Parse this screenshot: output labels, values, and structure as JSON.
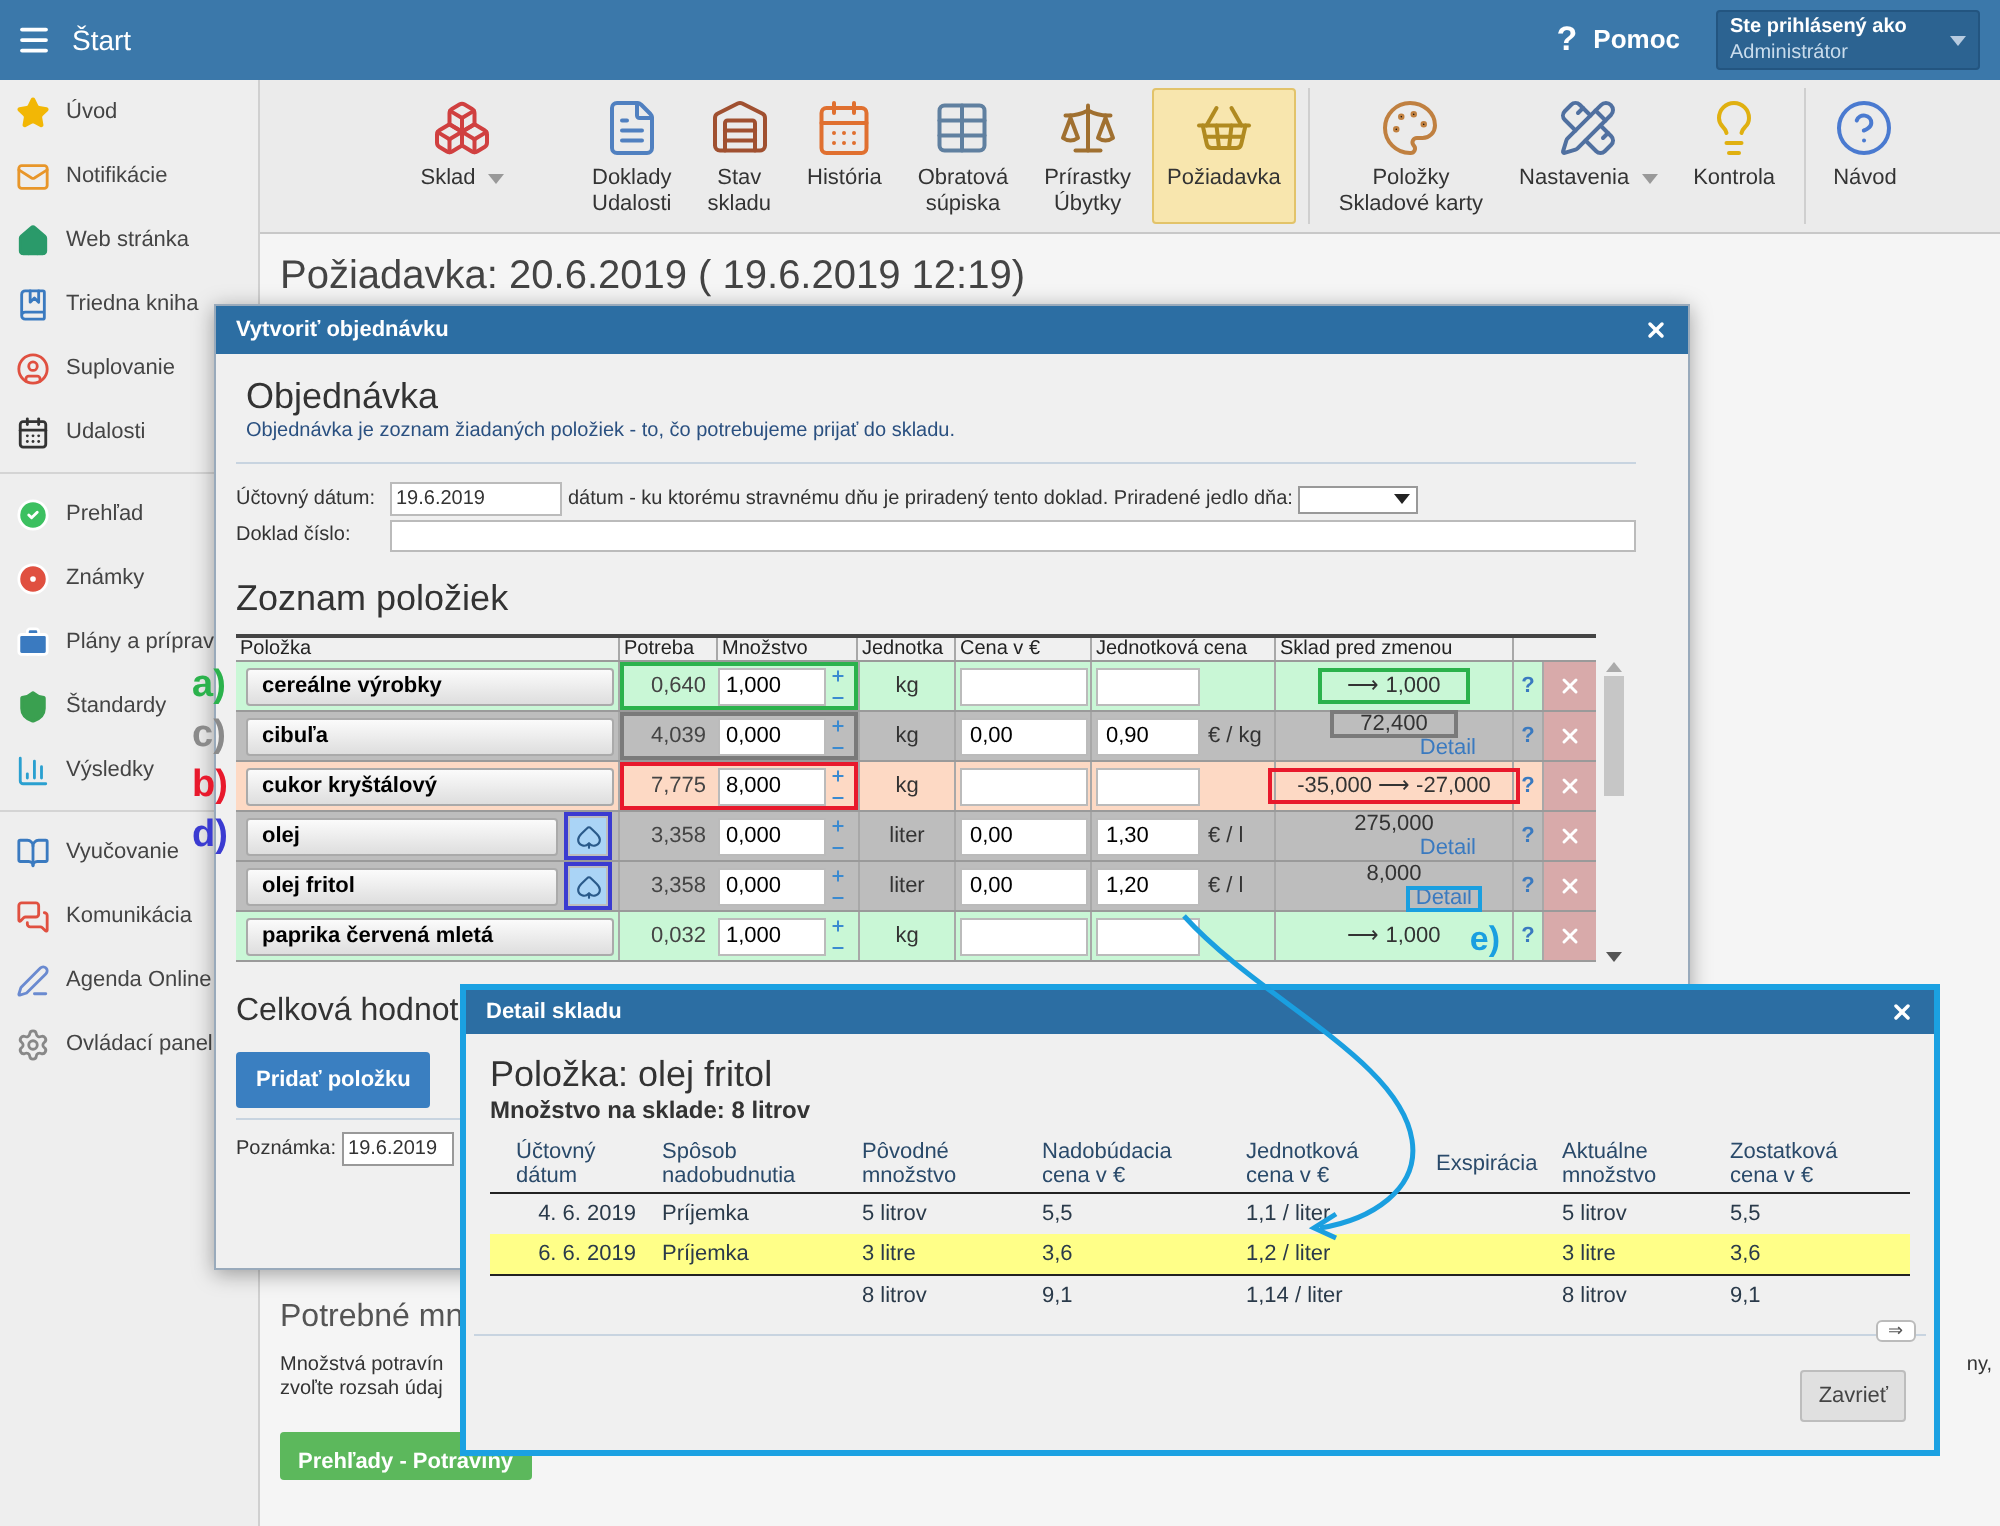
{
  "header": {
    "title": "Štart",
    "help_icon": "?",
    "help": "Pomoc",
    "user_label": "Ste prihlásený ako",
    "user_name": "Administrátor"
  },
  "sidebar": {
    "groups": [
      {
        "items": [
          {
            "label": "Úvod"
          },
          {
            "label": "Notifikácie"
          },
          {
            "label": "Web stránka"
          },
          {
            "label": "Triedna kniha"
          },
          {
            "label": "Suplovanie"
          },
          {
            "label": "Udalosti"
          }
        ]
      },
      {
        "items": [
          {
            "label": "Prehľad"
          },
          {
            "label": "Známky"
          },
          {
            "label": "Plány a príprav"
          },
          {
            "label": "Štandardy"
          },
          {
            "label": "Výsledky"
          }
        ]
      },
      {
        "items": [
          {
            "label": "Vyučovanie"
          },
          {
            "label": "Komunikácia"
          },
          {
            "label": "Agenda Online"
          },
          {
            "label": "Ovládací panel"
          }
        ]
      }
    ]
  },
  "toolbar": {
    "groups": [
      {
        "items": [
          {
            "lines": [
              "Sklad"
            ],
            "dropdown": true,
            "selected": false
          },
          {
            "lines": [
              "Doklady",
              "Udalosti"
            ],
            "dropdown": false,
            "selected": false
          },
          {
            "lines": [
              "Stav",
              "skladu"
            ],
            "dropdown": false,
            "selected": false
          },
          {
            "lines": [
              "História"
            ],
            "dropdown": false,
            "selected": false
          },
          {
            "lines": [
              "Obratová",
              "súpiska"
            ],
            "dropdown": false,
            "selected": false
          },
          {
            "lines": [
              "Prírastky",
              "Úbytky"
            ],
            "dropdown": false,
            "selected": false
          },
          {
            "lines": [
              "Požiadavka"
            ],
            "dropdown": false,
            "selected": true
          }
        ]
      },
      {
        "items": [
          {
            "lines": [
              "Položky",
              "Skladové karty"
            ],
            "dropdown": false,
            "selected": false
          },
          {
            "lines": [
              "Nastavenia"
            ],
            "dropdown": true,
            "selected": false
          },
          {
            "lines": [
              "Kontrola"
            ],
            "dropdown": false,
            "selected": false
          }
        ]
      },
      {
        "items": [
          {
            "lines": [
              "Návod"
            ],
            "dropdown": false,
            "selected": false
          }
        ]
      }
    ]
  },
  "page_title": "Požiadavka: 20.6.2019 ( 19.6.2019 12:19)",
  "background": {
    "section_heading": "Potrebné mn",
    "text_lines": [
      "Množstvá potravín",
      "zvoľte rozsah údaj"
    ],
    "text_right": "ny,",
    "button": "Prehľady - Potraviny"
  },
  "order_dialog": {
    "title": "Vytvoriť objednávku",
    "heading": "Objednávka",
    "description": "Objednávka je zoznam žiadaných položiek - to, čo potrebujeme prijať do skladu.",
    "date_label": "Účtovný dátum:",
    "date_value": "19.6.2019",
    "date_hint": "dátum - ku ktorému stravnému dňu je priradený tento doklad. Priradené jedlo dňa:",
    "doc_label": "Doklad číslo:",
    "list_heading": "Zoznam položiek",
    "columns": [
      "Položka",
      "Potreba",
      "Množstvo",
      "Jednotka",
      "Cena v €",
      "Jednotková cena",
      "Sklad pred zmenou"
    ],
    "rows": [
      {
        "name": "cereálne výrobky",
        "potreba": "0,640",
        "mnozstvo": "1,000",
        "unit": "kg",
        "sklad": "⟶ 1,000",
        "color": "#c9f7d6",
        "help": "?",
        "spade": false,
        "highlight": {
          "color": "#2bb24c"
        },
        "marker": {
          "label": "a)",
          "color": "#2bb24c"
        }
      },
      {
        "name": "cibuľa",
        "potreba": "4,039",
        "mnozstvo": "0,000",
        "unit": "kg",
        "cena": "0,00",
        "jednotkova_cena": "0,90",
        "price_unit": "€ / kg",
        "sklad": "72,400",
        "detail": "Detail",
        "color": "#bdbdbd",
        "help": "?",
        "spade": false,
        "highlight": {
          "color": "#7a7a7a"
        },
        "marker": {
          "label": "c)",
          "color": "#8a8a8a"
        }
      },
      {
        "name": "cukor kryštálový",
        "potreba": "7,775",
        "mnozstvo": "8,000",
        "unit": "kg",
        "sklad": "-35,000 ⟶ -27,000",
        "color": "#fdd9c4",
        "help": "?",
        "spade": false,
        "highlight": {
          "color": "#e8192c"
        },
        "marker": {
          "label": "b)",
          "color": "#e8192c"
        }
      },
      {
        "name": "olej",
        "potreba": "3,358",
        "mnozstvo": "0,000",
        "unit": "liter",
        "cena": "0,00",
        "jednotkova_cena": "1,30",
        "price_unit": "€ / l",
        "sklad": "275,000",
        "detail": "Detail",
        "color": "#bdbdbd",
        "help": "?",
        "spade": true,
        "spade_highlight": {
          "color": "#3b3bd1"
        },
        "marker": {
          "label": "d)",
          "color": "#3b3bd1"
        }
      },
      {
        "name": "olej fritol",
        "potreba": "3,358",
        "mnozstvo": "0,000",
        "unit": "liter",
        "cena": "0,00",
        "jednotkova_cena": "1,20",
        "price_unit": "€ / l",
        "sklad": "8,000",
        "detail": "Detail",
        "detail_highlight": {
          "color": "#1a9fe0"
        },
        "color": "#bdbdbd",
        "help": "?",
        "spade": true,
        "spade_highlight": {
          "color": "#3b3bd1"
        }
      },
      {
        "name": "paprika červená mletá",
        "potreba": "0,032",
        "mnozstvo": "1,000",
        "unit": "kg",
        "sklad": "⟶ 1,000",
        "color": "#c9f7d6",
        "help": "?",
        "spade": false,
        "cell_marker": {
          "label": "e)",
          "color": "#1a9fe0"
        }
      }
    ],
    "total_label": "Celková hodnot",
    "add_button": "Pridať položku",
    "note_label": "Poznámka:",
    "note_value": "19.6.2019"
  },
  "detail_dialog": {
    "title": "Detail skladu",
    "item_heading": "Položka: olej fritol",
    "stock_line": "Množstvo na sklade: 8 litrov",
    "columns": [
      [
        "Účtovný",
        "dátum"
      ],
      [
        "Spôsob",
        "nadobudnutia"
      ],
      [
        "Pôvodné",
        "množstvo"
      ],
      [
        "Nadobúdacia",
        "cena v €"
      ],
      [
        "Jednotková",
        "cena v €"
      ],
      [
        "Exspirácia"
      ],
      [
        "Aktuálne",
        "množstvo"
      ],
      [
        "Zostatková",
        "cena v €"
      ]
    ],
    "rows": [
      {
        "datum": "4. 6. 2019",
        "sposob": "Príjemka",
        "povodne": "5 litrov",
        "nadobudacia": "5,5",
        "jednotkova": "1,1 / liter",
        "aktualne": "5 litrov",
        "zostatkova": "5,5",
        "selected": false
      },
      {
        "datum": "6. 6. 2019",
        "sposob": "Príjemka",
        "povodne": "3 litre",
        "nadobudacia": "3,6",
        "jednotkova": "1,2 / liter",
        "aktualne": "3 litre",
        "zostatkova": "3,6",
        "selected": true
      }
    ],
    "total": {
      "povodne": "8 litrov",
      "nadobudacia": "9,1",
      "jednotkova": "1,14 / liter",
      "aktualne": "8 litrov",
      "zostatkova": "9,1"
    },
    "scroll_button": "⇒",
    "close_button": "Zavrieť"
  }
}
